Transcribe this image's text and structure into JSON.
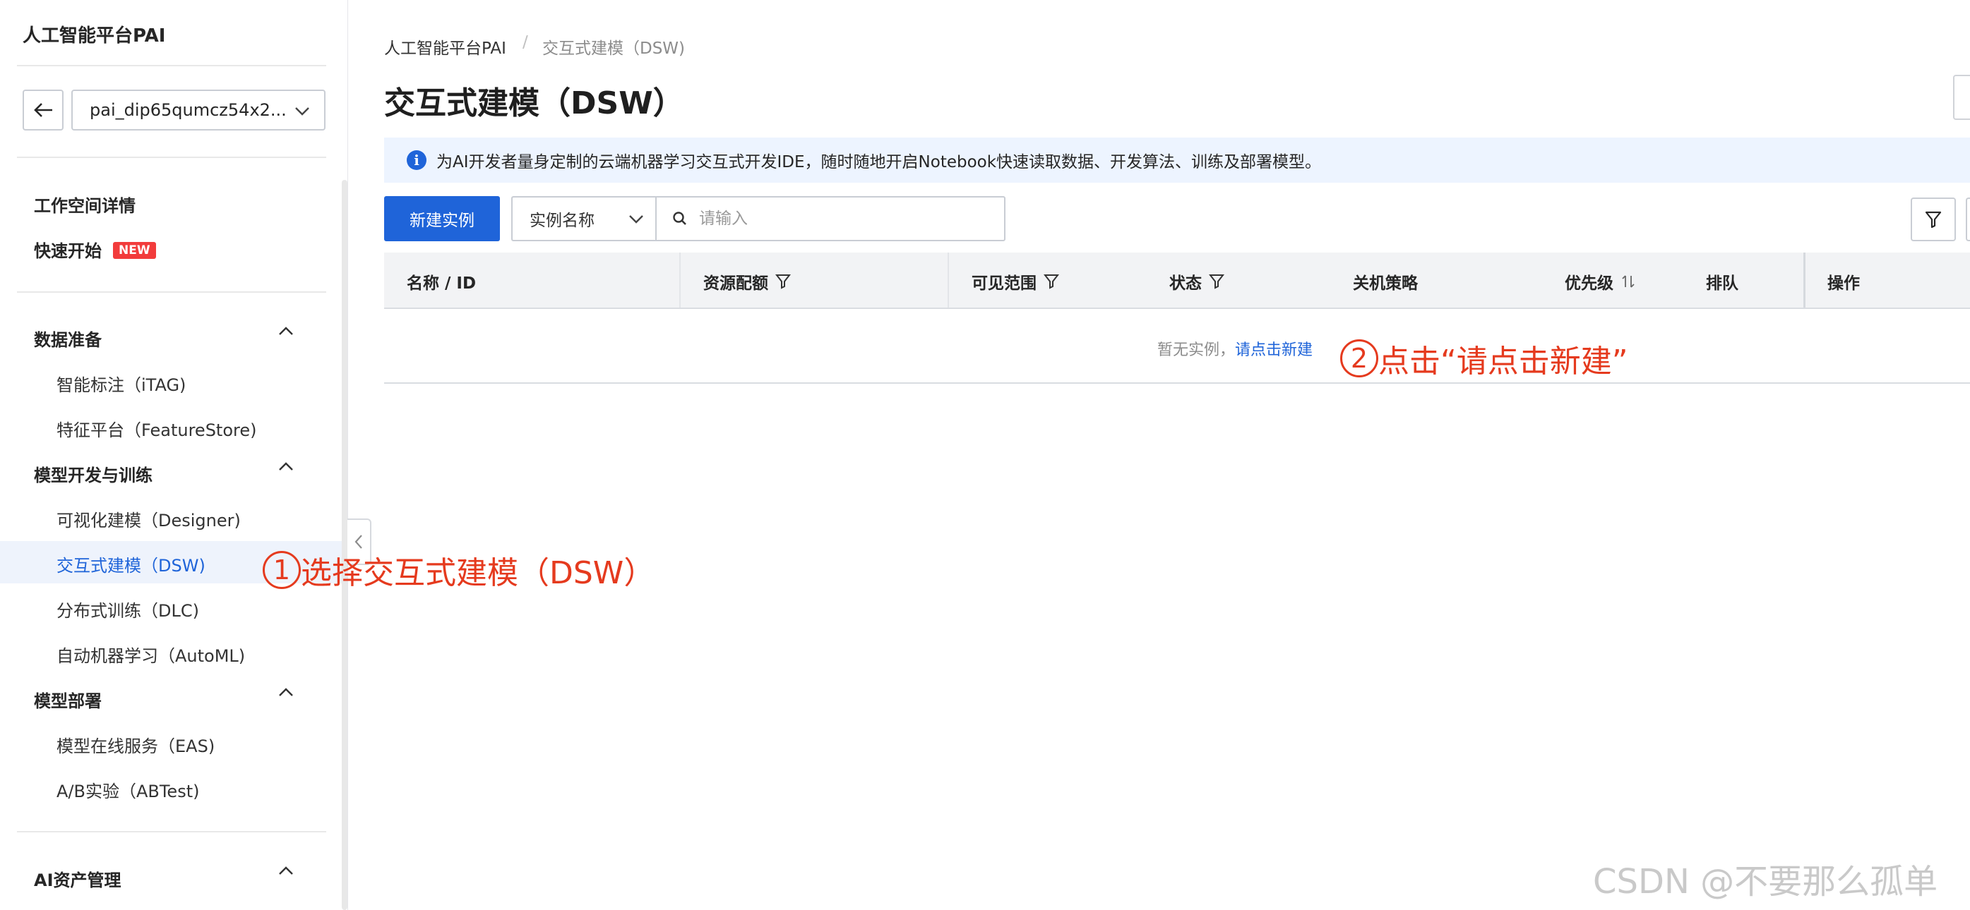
{
  "sidebar": {
    "title": "人工智能平台PAI",
    "workspace": "pai_dip65qumcz54x2...",
    "top_items": [
      {
        "label": "工作空间详情"
      },
      {
        "label": "快速开始",
        "badge": "NEW"
      }
    ],
    "groups": [
      {
        "label": "数据准备",
        "items": [
          "智能标注（iTAG)",
          "特征平台（FeatureStore)"
        ]
      },
      {
        "label": "模型开发与训练",
        "items": [
          "可视化建模（Designer)",
          "交互式建模（DSW)",
          "分布式训练（DLC)",
          "自动机器学习（AutoML)"
        ]
      },
      {
        "label": "模型部署",
        "items": [
          "模型在线服务（EAS)",
          "A/B实验（ABTest)"
        ]
      },
      {
        "label": "AI资产管理",
        "items": []
      }
    ],
    "active_item": "交互式建模（DSW)"
  },
  "breadcrumb": {
    "root": "人工智能平台PAI",
    "separator": "/",
    "current": "交互式建模（DSW)"
  },
  "page": {
    "title": "交互式建模（DSW）",
    "info": "为AI开发者量身定制的云端机器学习交互式开发IDE，随时随地开启Notebook快速读取数据、开发算法、训练及部署模型。"
  },
  "toolbar": {
    "new_button": "新建实例",
    "field_select": "实例名称",
    "search_placeholder": "请输入"
  },
  "table": {
    "columns": [
      "名称 / ID",
      "资源配额",
      "可见范围",
      "状态",
      "关机策略",
      "优先级",
      "排队",
      "操作"
    ],
    "empty_text": "暂无实例，",
    "empty_link": "请点击新建"
  },
  "annotations": {
    "step1_num": "1",
    "step1_text": "选择交互式建模（DSW）",
    "step2_num": "2",
    "step2_text": "点击“请点击新建”"
  },
  "watermark": "CSDN @不要那么孤单",
  "colors": {
    "accent": "#1f64d9",
    "annotation": "#e53a1e",
    "badge": "#f23c3c"
  }
}
